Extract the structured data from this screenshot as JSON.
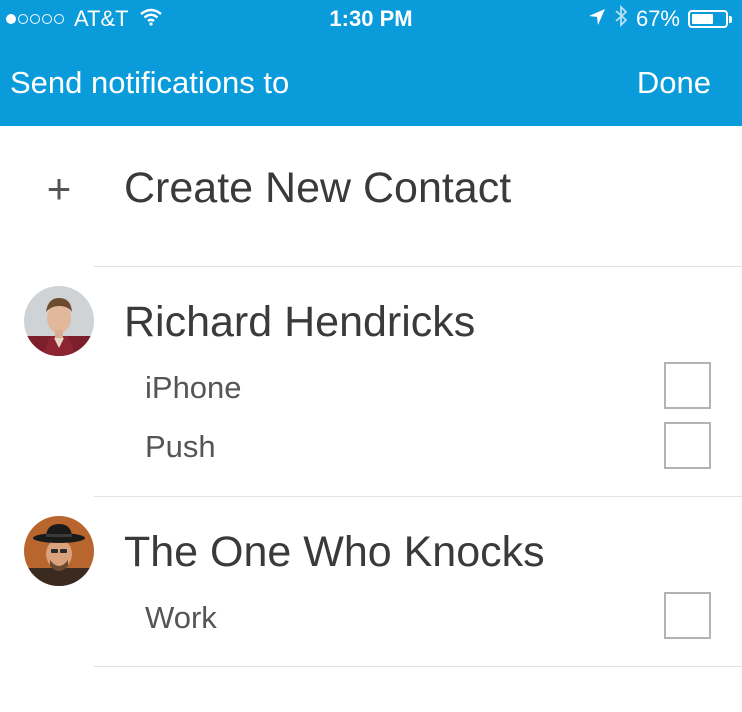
{
  "status_bar": {
    "signal_bars": 1,
    "signal_total": 5,
    "carrier": "AT&T",
    "wifi_icon": "wifi-icon",
    "time": "1:30 PM",
    "location_icon": "location-arrow-icon",
    "bluetooth_icon": "bluetooth-icon",
    "battery_percent": "67%",
    "battery_level": 0.67
  },
  "nav": {
    "title": "Send notifications to",
    "done_label": "Done"
  },
  "create_contact": {
    "icon": "plus-icon",
    "label": "Create New Contact"
  },
  "contacts": [
    {
      "name": "Richard Hendricks",
      "channels": [
        {
          "label": "iPhone",
          "checked": false
        },
        {
          "label": "Push",
          "checked": false
        }
      ]
    },
    {
      "name": "The One Who Knocks",
      "channels": [
        {
          "label": "Work",
          "checked": false
        }
      ]
    }
  ],
  "colors": {
    "header_bg": "#0a9bdb",
    "text": "#3a3a3a",
    "divider": "#e2e2e2",
    "checkbox_border": "#b3b3b3"
  }
}
